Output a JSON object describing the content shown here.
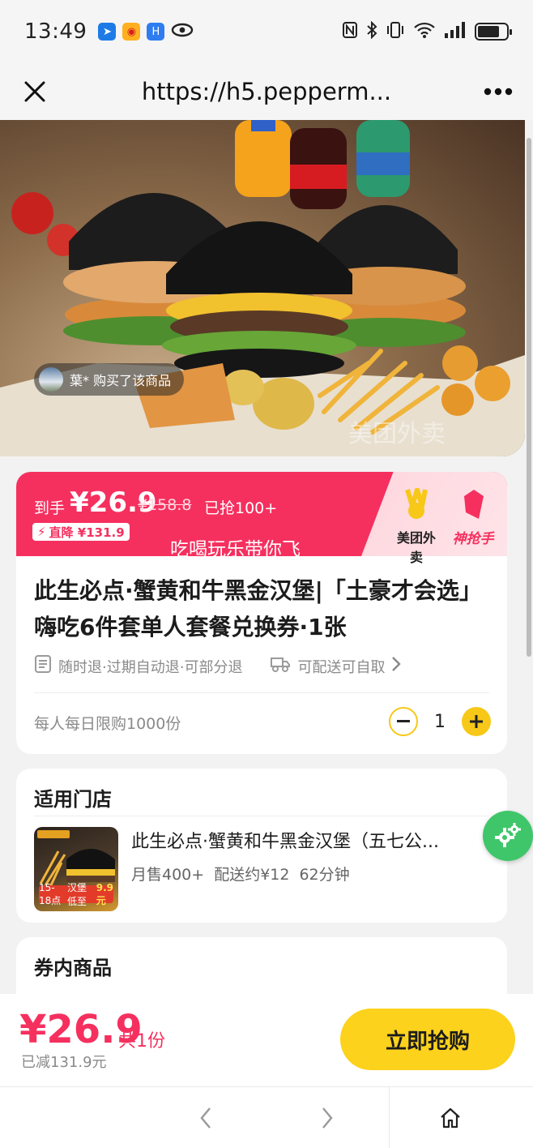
{
  "status_bar": {
    "time": "13:49",
    "apps": [
      "app-blue-icon",
      "weibo-icon",
      "app-h-icon",
      "eye-icon"
    ],
    "right_icons": [
      "nfc-icon",
      "bluetooth-icon",
      "vibrate-icon",
      "wifi-icon",
      "signal-icon",
      "battery-icon"
    ],
    "battery_level": 0.75
  },
  "browser": {
    "url": "https://h5.pepperm...",
    "close_icon": "close-icon",
    "more_icon": "more-icon"
  },
  "hero": {
    "buyer_text": "葉* 购买了该商品",
    "watermark": "美团外卖"
  },
  "price_banner": {
    "label": "到手",
    "price": "¥26.9",
    "original_price": "¥158.8",
    "sold": "已抢100+",
    "discount": "直降 ¥131.9",
    "slogan": "吃喝玩乐带你飞",
    "brand1": "美团外卖",
    "brand2": "神抢手",
    "colors": {
      "banner": "#f5305f",
      "accent": "#fcd21c"
    }
  },
  "product": {
    "title": "此生必点·蟹黄和牛黑金汉堡|「土豪才会选」嗨吃6件套单人套餐兑换券·1张",
    "policy": "随时退·过期自动退·可部分退",
    "delivery": "可配送可自取",
    "limit": "每人每日限购1000份",
    "quantity": "1"
  },
  "stores": {
    "title": "适用门店",
    "store_name": "此生必点·蟹黄和牛黑金汉堡（五七公...",
    "monthly_sales": "月售400+",
    "delivery_fee": "配送约¥12",
    "delivery_time": "62分钟",
    "thumb_badge_label": "15-18点",
    "thumb_badge_text": "汉堡低至",
    "thumb_price": "9.9元"
  },
  "goods": {
    "title": "券内商品"
  },
  "buy_bar": {
    "price": "¥26.9",
    "qty": "共1份",
    "saved": "已减131.9元",
    "button": "立即抢购"
  },
  "nav": {
    "back_icon": "back-arrow-icon",
    "forward_icon": "forward-arrow-icon",
    "home_icon": "home-icon"
  }
}
